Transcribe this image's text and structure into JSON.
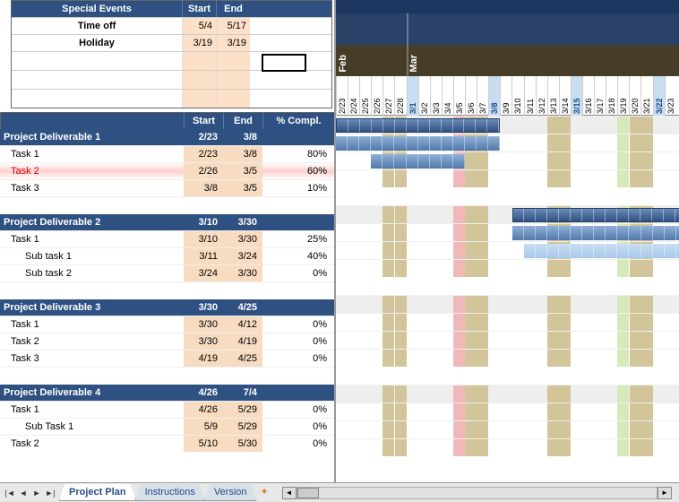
{
  "events": {
    "title": "Special Events",
    "cols": [
      "Start",
      "End"
    ],
    "rows": [
      {
        "name": "Time off",
        "start": "5/4",
        "end": "5/17"
      },
      {
        "name": "Holiday",
        "start": "3/19",
        "end": "3/19"
      }
    ]
  },
  "task_cols": {
    "start": "Start",
    "end": "End",
    "compl": "% Compl."
  },
  "timeline": {
    "months": [
      {
        "name": "Feb",
        "at": 0
      },
      {
        "name": "Mar",
        "at": 6
      }
    ],
    "dates": [
      "2/23",
      "2/24",
      "2/25",
      "2/26",
      "2/27",
      "2/28",
      "3/1",
      "3/2",
      "3/3",
      "3/4",
      "3/5",
      "3/6",
      "3/7",
      "3/8",
      "3/9",
      "3/10",
      "3/11",
      "3/12",
      "3/13",
      "3/14",
      "3/15",
      "3/16",
      "3/17",
      "3/18",
      "3/19",
      "3/20",
      "3/21",
      "3/22",
      "3/23"
    ],
    "highlight": [
      6,
      13,
      20,
      27
    ]
  },
  "deliverables": [
    {
      "name": "Project Deliverable 1",
      "start": "2/23",
      "end": "3/8",
      "tasks": [
        {
          "name": "Task 1",
          "start": "2/23",
          "end": "3/8",
          "compl": "80%"
        },
        {
          "name": "Task 2",
          "start": "2/26",
          "end": "3/5",
          "compl": "60%",
          "critical": true
        },
        {
          "name": "Task 3",
          "start": "3/8",
          "end": "3/5",
          "compl": "10%"
        }
      ]
    },
    {
      "name": "Project Deliverable 2",
      "start": "3/10",
      "end": "3/30",
      "tasks": [
        {
          "name": "Task 1",
          "start": "3/10",
          "end": "3/30",
          "compl": "25%"
        },
        {
          "name": "Sub task 1",
          "start": "3/11",
          "end": "3/24",
          "compl": "40%",
          "sub": true
        },
        {
          "name": "Sub task 2",
          "start": "3/24",
          "end": "3/30",
          "compl": "0%",
          "sub": true
        }
      ]
    },
    {
      "name": "Project Deliverable 3",
      "start": "3/30",
      "end": "4/25",
      "tasks": [
        {
          "name": "Task 1",
          "start": "3/30",
          "end": "4/12",
          "compl": "0%"
        },
        {
          "name": "Task 2",
          "start": "3/30",
          "end": "4/19",
          "compl": "0%"
        },
        {
          "name": "Task 3",
          "start": "4/19",
          "end": "4/25",
          "compl": "0%"
        }
      ]
    },
    {
      "name": "Project Deliverable 4",
      "start": "4/26",
      "end": "7/4",
      "tasks": [
        {
          "name": "Task 1",
          "start": "4/26",
          "end": "5/29",
          "compl": "0%"
        },
        {
          "name": "Sub Task 1",
          "start": "5/9",
          "end": "5/29",
          "compl": "0%",
          "sub": true
        },
        {
          "name": "Task 2",
          "start": "5/10",
          "end": "5/30",
          "compl": "0%"
        }
      ]
    }
  ],
  "tabs": {
    "active": "Project Plan",
    "others": [
      "Instructions",
      "Version"
    ]
  },
  "chart_data": {
    "type": "gantt",
    "date_range": [
      "2/23",
      "3/23"
    ],
    "overlays": {
      "tan": [
        4,
        5,
        11,
        12,
        18,
        19,
        25,
        26
      ],
      "pink": [
        10
      ],
      "green": [
        24
      ]
    },
    "bars": [
      {
        "group": 0,
        "row": "head",
        "from": 0,
        "to": 13,
        "style": "main"
      },
      {
        "group": 0,
        "row": 0,
        "from": 0,
        "to": 13,
        "style": "task"
      },
      {
        "group": 0,
        "row": 1,
        "from": 3,
        "to": 10,
        "style": "task"
      },
      {
        "group": 0,
        "row": 2,
        "from": 10,
        "to": 13,
        "style": "none"
      },
      {
        "group": 1,
        "row": "head",
        "from": 15,
        "to": 29,
        "style": "main"
      },
      {
        "group": 1,
        "row": 0,
        "from": 15,
        "to": 29,
        "style": "task"
      },
      {
        "group": 1,
        "row": 1,
        "from": 16,
        "to": 29,
        "style": "light"
      },
      {
        "group": 1,
        "row": 2,
        "from": 29,
        "to": 29,
        "style": "none"
      }
    ]
  }
}
